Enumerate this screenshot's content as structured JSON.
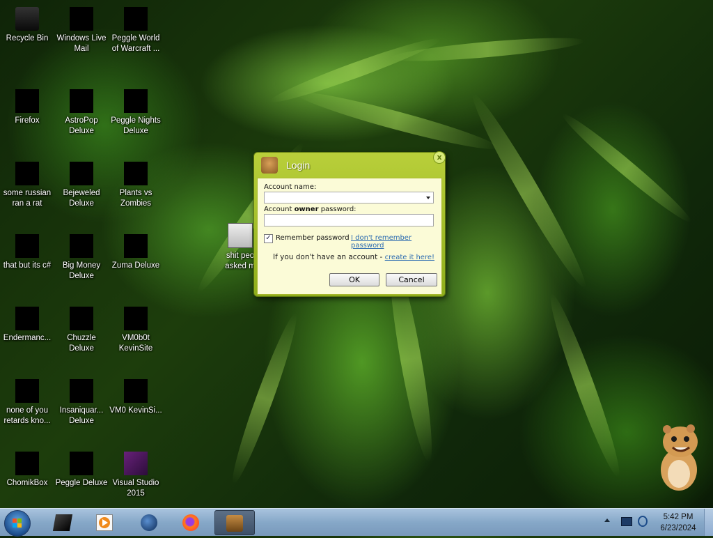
{
  "desktop": {
    "icons": [
      {
        "label": "Recycle Bin",
        "icon": "recycle-bin-icon"
      },
      {
        "label": "Windows Live Mail",
        "icon": "windows-live-mail-icon"
      },
      {
        "label": "Peggle World of Warcraft ...",
        "icon": "peggle-wow-icon"
      },
      {
        "label": "Firefox",
        "icon": "firefox-icon"
      },
      {
        "label": "AstroPop Deluxe",
        "icon": "astropop-icon"
      },
      {
        "label": "Peggle Nights Deluxe",
        "icon": "peggle-nights-icon"
      },
      {
        "label": "some russian ran a rat",
        "icon": "file-icon"
      },
      {
        "label": "Bejeweled Deluxe",
        "icon": "bejeweled-icon"
      },
      {
        "label": "Plants vs Zombies",
        "icon": "plants-vs-zombies-icon"
      },
      {
        "label": "that but its c#",
        "icon": "file-icon"
      },
      {
        "label": "Big Money Deluxe",
        "icon": "big-money-icon"
      },
      {
        "label": "Zuma Deluxe",
        "icon": "zuma-icon"
      },
      {
        "label": "Endermanc...",
        "icon": "app-icon"
      },
      {
        "label": "Chuzzle Deluxe",
        "icon": "chuzzle-icon"
      },
      {
        "label": "VM0b0t KevinSite",
        "icon": "app-icon"
      },
      {
        "label": "none of you retards kno...",
        "icon": "chrome-icon"
      },
      {
        "label": "Insaniquar... Deluxe",
        "icon": "insaniquarium-icon"
      },
      {
        "label": "VM0 KevinSi...",
        "icon": "app-icon"
      },
      {
        "label": "ChomikBox",
        "icon": "chomikbox-icon"
      },
      {
        "label": "Peggle Deluxe",
        "icon": "peggle-icon"
      },
      {
        "label": "Visual Studio 2015",
        "icon": "visual-studio-icon"
      },
      {
        "label": "shit peo asked m",
        "icon": "file-icon"
      }
    ]
  },
  "login": {
    "title": "Login",
    "close": "x",
    "account_name_label": "Account name:",
    "account_name_value": "",
    "password_label_pre": "Account ",
    "password_label_bold": "owner",
    "password_label_post": " password:",
    "password_value": "",
    "remember_label": "Remember password",
    "remember_checked": true,
    "forgot_link": "I don't remember password",
    "no_account_text": "If you don't have an account - ",
    "create_link": "create it here!",
    "ok_label": "OK",
    "cancel_label": "Cancel"
  },
  "taskbar": {
    "apps": [
      "terminal-icon",
      "media-player-icon",
      "globe-icon",
      "firefox-icon",
      "chomikbox-icon"
    ],
    "active_app": "chomikbox-icon",
    "time": "5:42 PM",
    "date": "6/23/2024"
  }
}
